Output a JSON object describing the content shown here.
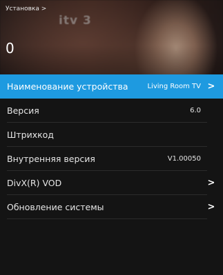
{
  "header": {
    "breadcrumb": "Установка >",
    "current_value": "0",
    "video_logo_text": "itv 3"
  },
  "menu": {
    "items": [
      {
        "label": "Наименование устройства",
        "value": "Living Room TV",
        "chevron": ">",
        "selected": true
      },
      {
        "label": "Версия",
        "value": "6.0",
        "chevron": "",
        "selected": false
      },
      {
        "label": "Штрихкод",
        "value": "",
        "chevron": "",
        "selected": false
      },
      {
        "label": "Внутренняя версия",
        "value": "V1.00050",
        "chevron": "",
        "selected": false
      },
      {
        "label": "DivX(R) VOD",
        "value": "",
        "chevron": ">",
        "selected": false
      },
      {
        "label": "Обновление системы",
        "value": "",
        "chevron": ">",
        "selected": false
      }
    ]
  },
  "colors": {
    "accent": "#1e9ae0",
    "panel": "#141414",
    "separator": "#2c2c2c"
  }
}
